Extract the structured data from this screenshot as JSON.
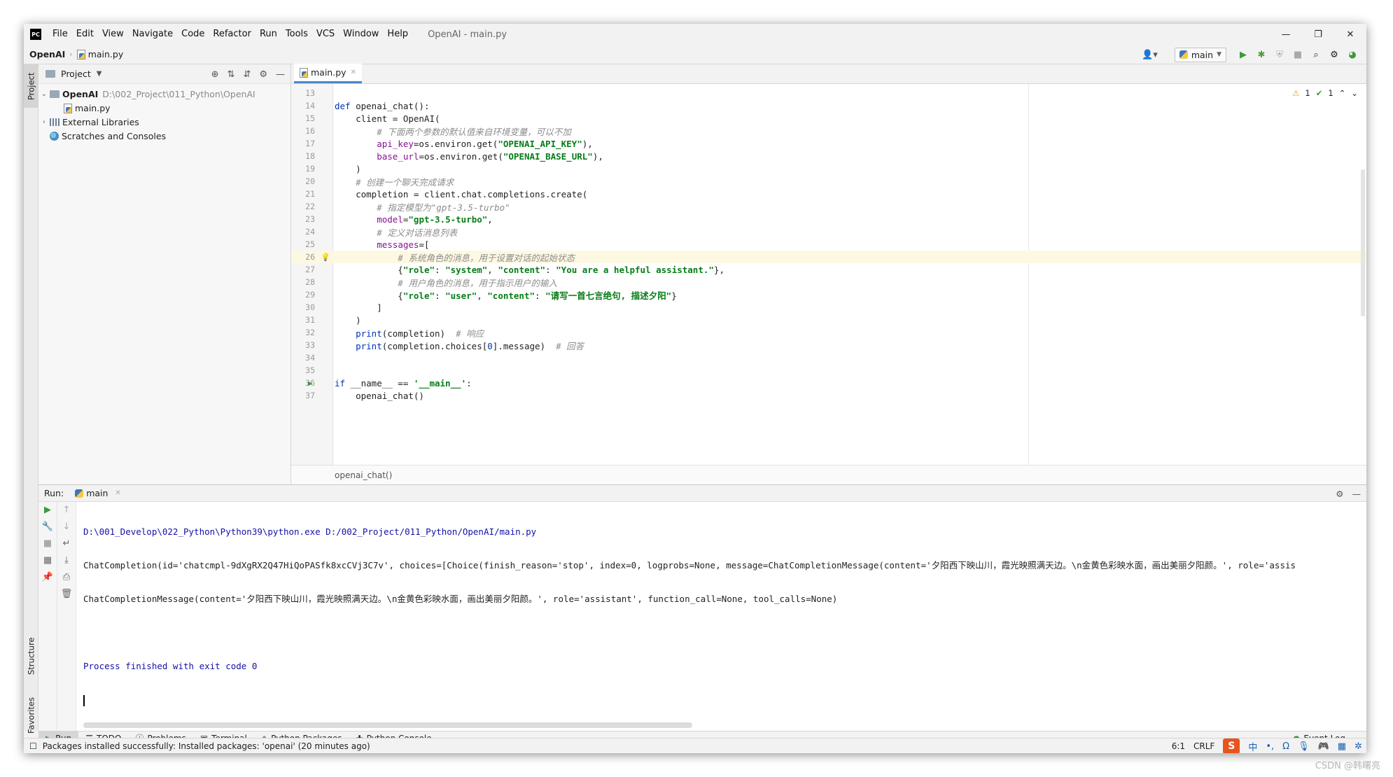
{
  "window": {
    "title": "OpenAI - main.py",
    "logo": "PC",
    "minimize": "—",
    "restore": "❐",
    "close": "✕"
  },
  "menu": [
    "File",
    "Edit",
    "View",
    "Navigate",
    "Code",
    "Refactor",
    "Run",
    "Tools",
    "VCS",
    "Window",
    "Help"
  ],
  "navbar": {
    "project": "OpenAI",
    "file": "main.py",
    "run_config": "main"
  },
  "stripe": {
    "project": "Project",
    "structure": "Structure",
    "favorites": "Favorites"
  },
  "project_panel": {
    "title": "Project",
    "tree": {
      "root_name": "OpenAI",
      "root_path": "D:\\002_Project\\011_Python\\OpenAI",
      "file": "main.py",
      "external": "External Libraries",
      "scratches": "Scratches and Consoles"
    }
  },
  "editor": {
    "tab": "main.py",
    "warnings": "1",
    "checks": "1",
    "breadcrumb": "openai_chat()",
    "lines": [
      {
        "n": "13",
        "segments": []
      },
      {
        "n": "14",
        "segments": [
          {
            "t": "def ",
            "c": "kw"
          },
          {
            "t": "openai_chat():",
            "c": ""
          }
        ]
      },
      {
        "n": "15",
        "segments": [
          {
            "t": "    client = OpenAI(",
            "c": ""
          }
        ]
      },
      {
        "n": "16",
        "segments": [
          {
            "t": "        # 下面两个参数的默认值来自环境变量，可以不加",
            "c": "cmt"
          }
        ]
      },
      {
        "n": "17",
        "segments": [
          {
            "t": "        ",
            "c": ""
          },
          {
            "t": "api_key",
            "c": "param"
          },
          {
            "t": "=os.environ.get(",
            "c": ""
          },
          {
            "t": "\"OPENAI_API_KEY\"",
            "c": "str"
          },
          {
            "t": "),",
            "c": ""
          }
        ]
      },
      {
        "n": "18",
        "segments": [
          {
            "t": "        ",
            "c": ""
          },
          {
            "t": "base_url",
            "c": "param"
          },
          {
            "t": "=os.environ.get(",
            "c": ""
          },
          {
            "t": "\"OPENAI_BASE_URL\"",
            "c": "str"
          },
          {
            "t": "),",
            "c": ""
          }
        ]
      },
      {
        "n": "19",
        "segments": [
          {
            "t": "    )",
            "c": ""
          }
        ]
      },
      {
        "n": "20",
        "segments": [
          {
            "t": "    # 创建一个聊天完成请求",
            "c": "cmt"
          }
        ]
      },
      {
        "n": "21",
        "segments": [
          {
            "t": "    completion = client.chat.completions.create(",
            "c": ""
          }
        ]
      },
      {
        "n": "22",
        "segments": [
          {
            "t": "        # 指定模型为\"gpt-3.5-turbo\"",
            "c": "cmt"
          }
        ]
      },
      {
        "n": "23",
        "segments": [
          {
            "t": "        ",
            "c": ""
          },
          {
            "t": "model",
            "c": "param"
          },
          {
            "t": "=",
            "c": ""
          },
          {
            "t": "\"gpt-3.5-turbo\"",
            "c": "str"
          },
          {
            "t": ",",
            "c": ""
          }
        ]
      },
      {
        "n": "24",
        "segments": [
          {
            "t": "        # 定义对话消息列表",
            "c": "cmt"
          }
        ]
      },
      {
        "n": "25",
        "segments": [
          {
            "t": "        ",
            "c": ""
          },
          {
            "t": "messages",
            "c": "param"
          },
          {
            "t": "=[",
            "c": ""
          }
        ]
      },
      {
        "n": "26",
        "segments": [
          {
            "t": "            # 系统角色的消息，用于设置对话的起始状态",
            "c": "cmt"
          }
        ],
        "current": true
      },
      {
        "n": "27",
        "segments": [
          {
            "t": "            {",
            "c": ""
          },
          {
            "t": "\"role\"",
            "c": "str"
          },
          {
            "t": ": ",
            "c": ""
          },
          {
            "t": "\"system\"",
            "c": "str"
          },
          {
            "t": ", ",
            "c": ""
          },
          {
            "t": "\"content\"",
            "c": "str"
          },
          {
            "t": ": ",
            "c": ""
          },
          {
            "t": "\"You are a helpful assistant.\"",
            "c": "str"
          },
          {
            "t": "},",
            "c": ""
          }
        ]
      },
      {
        "n": "28",
        "segments": [
          {
            "t": "            # 用户角色的消息，用于指示用户的输入",
            "c": "cmt"
          }
        ]
      },
      {
        "n": "29",
        "segments": [
          {
            "t": "            {",
            "c": ""
          },
          {
            "t": "\"role\"",
            "c": "str"
          },
          {
            "t": ": ",
            "c": ""
          },
          {
            "t": "\"user\"",
            "c": "str"
          },
          {
            "t": ", ",
            "c": ""
          },
          {
            "t": "\"content\"",
            "c": "str"
          },
          {
            "t": ": ",
            "c": ""
          },
          {
            "t": "\"请写一首七言绝句, 描述夕阳\"",
            "c": "str"
          },
          {
            "t": "}",
            "c": ""
          }
        ]
      },
      {
        "n": "30",
        "segments": [
          {
            "t": "        ]",
            "c": ""
          }
        ]
      },
      {
        "n": "31",
        "segments": [
          {
            "t": "    )",
            "c": ""
          }
        ]
      },
      {
        "n": "32",
        "segments": [
          {
            "t": "    ",
            "c": ""
          },
          {
            "t": "print",
            "c": "builtin"
          },
          {
            "t": "(completion)  ",
            "c": ""
          },
          {
            "t": "# 响应",
            "c": "cmt"
          }
        ]
      },
      {
        "n": "33",
        "segments": [
          {
            "t": "    ",
            "c": ""
          },
          {
            "t": "print",
            "c": "builtin"
          },
          {
            "t": "(completion.choices[",
            "c": ""
          },
          {
            "t": "0",
            "c": "builtin"
          },
          {
            "t": "].message)  ",
            "c": ""
          },
          {
            "t": "# 回答",
            "c": "cmt"
          }
        ]
      },
      {
        "n": "34",
        "segments": []
      },
      {
        "n": "35",
        "segments": []
      },
      {
        "n": "36",
        "segments": [
          {
            "t": "if ",
            "c": "kw"
          },
          {
            "t": "__name__ == ",
            "c": ""
          },
          {
            "t": "'__main__'",
            "c": "str"
          },
          {
            "t": ":",
            "c": ""
          }
        ]
      },
      {
        "n": "37",
        "segments": [
          {
            "t": "    openai_chat()",
            "c": ""
          }
        ]
      }
    ]
  },
  "run": {
    "label": "Run:",
    "tab": "main",
    "console": {
      "cmd": "D:\\001_Develop\\022_Python\\Python39\\python.exe D:/002_Project/011_Python/OpenAI/main.py",
      "out1": "ChatCompletion(id='chatcmpl-9dXgRX2Q47HiQoPASfk8xcCVj3C7v', choices=[Choice(finish_reason='stop', index=0, logprobs=None, message=ChatCompletionMessage(content='夕阳西下映山川，霞光映照满天边。\\n金黄色彩映水面，画出美丽夕阳颜。', role='assis",
      "out2": "ChatCompletionMessage(content='夕阳西下映山川，霞光映照满天边。\\n金黄色彩映水面，画出美丽夕阳颜。', role='assistant', function_call=None, tool_calls=None)",
      "exit": "Process finished with exit code 0"
    }
  },
  "tool_tabs": {
    "run": "Run",
    "todo": "TODO",
    "problems": "Problems",
    "terminal": "Terminal",
    "packages": "Python Packages",
    "console": "Python Console",
    "event_log": "Event Log"
  },
  "status": {
    "message": "Packages installed successfully: Installed packages: 'openai' (20 minutes ago)",
    "position": "6:1",
    "line_sep": "CRLF",
    "ime_logo": "S",
    "ime_lang": "中"
  },
  "watermark": "CSDN @韩曙亮"
}
